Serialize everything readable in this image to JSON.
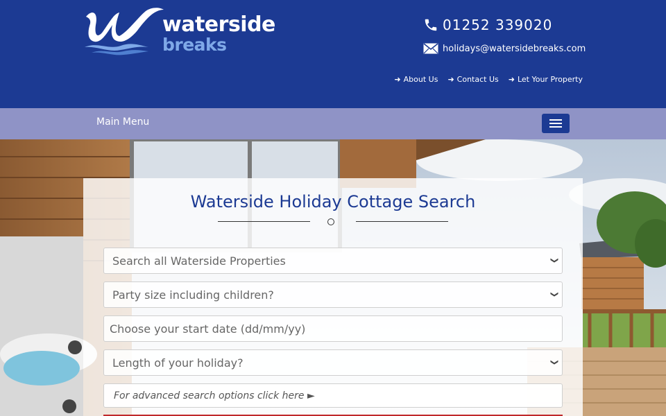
{
  "brand": {
    "word1": "waterside",
    "word2": "breaks"
  },
  "contact": {
    "phone_icon": "phone-icon",
    "phone": "01252 339020",
    "email_icon": "envelope-icon",
    "email": "holidays@watersidebreaks.com"
  },
  "top_links": [
    {
      "label": "About Us",
      "icon": "arrow-right-icon"
    },
    {
      "label": "Contact Us",
      "icon": "arrow-right-icon"
    },
    {
      "label": "Let Your Property",
      "icon": "arrow-right-icon"
    }
  ],
  "nav": {
    "label": "Main Menu",
    "menu_icon": "hamburger-icon"
  },
  "search": {
    "title": "Waterside Holiday Cottage Search",
    "property_select": "Search all Waterside Properties",
    "party_select": "Party size including children?",
    "date_placeholder": "Choose your start date (dd/mm/yy)",
    "length_select": "Length of your holiday?",
    "advanced_link": "For advanced search options click here  ►"
  },
  "colors": {
    "header_bg": "#1c3a93",
    "nav_bg": "#8f93c6",
    "title": "#1c3a93",
    "accent_red": "#c0282a"
  }
}
